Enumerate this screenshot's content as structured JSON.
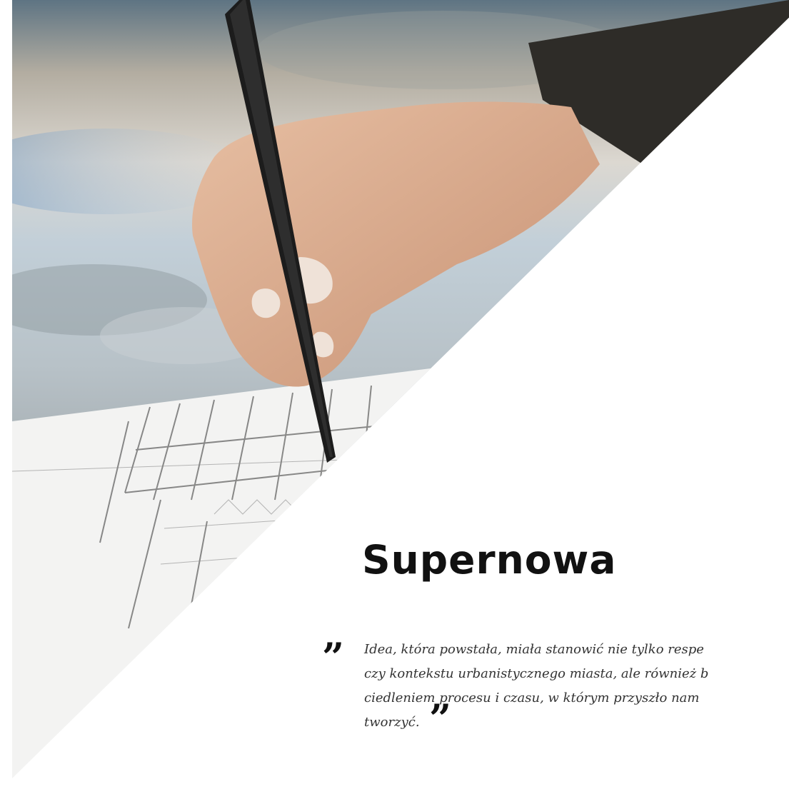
{
  "hero": {
    "title": "Supernowa",
    "quote": {
      "open_mark": "”",
      "lines": [
        "Idea, która powstała, miała stanowić nie tylko respe",
        "czy kontekstu urbanistycznego miasta, ale również b",
        "ciedleniem procesu i czasu, w którym przyszło nam",
        "tworzyć."
      ],
      "close_mark": "”"
    },
    "photo_icon": "architect-hand-drawing-photo"
  },
  "colors": {
    "background": "#ffffff",
    "title": "#111111",
    "quote_text": "#333333"
  }
}
